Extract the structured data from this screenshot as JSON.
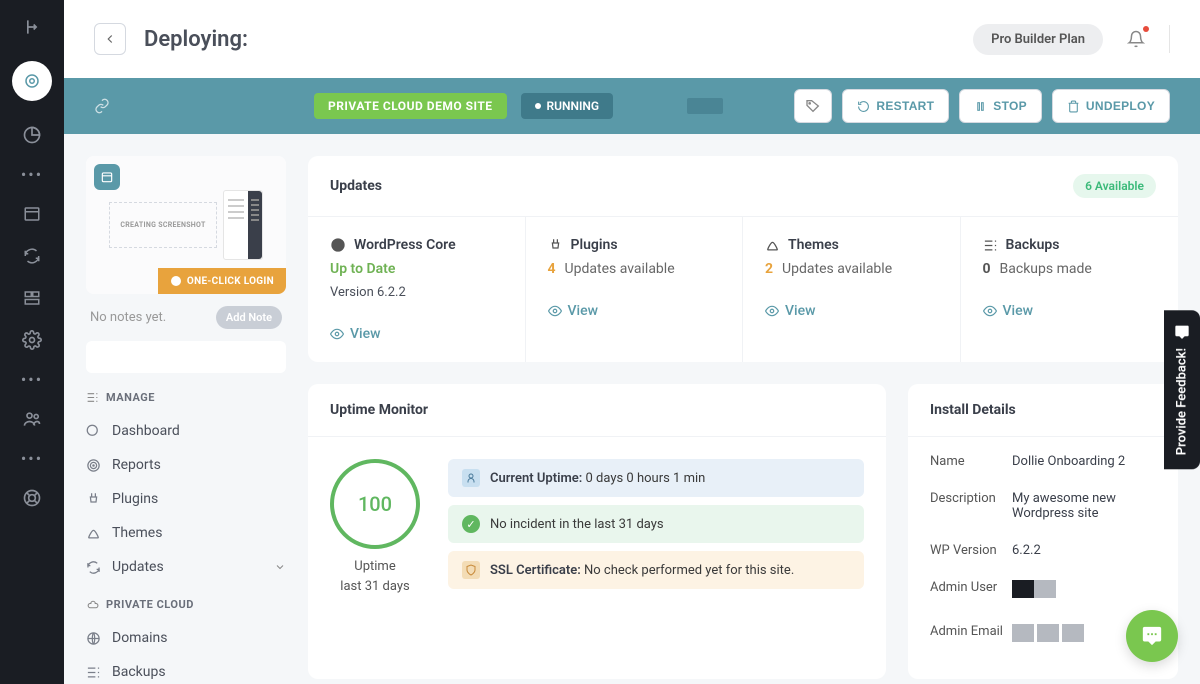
{
  "header": {
    "title": "Deploying:",
    "plan": "Pro Builder Plan"
  },
  "banner": {
    "site_badge": "PRIVATE CLOUD DEMO SITE",
    "status": "RUNNING",
    "restart": "RESTART",
    "stop": "STOP",
    "undeploy": "UNDEPLOY"
  },
  "preview": {
    "creating": "CREATING SCREENSHOT",
    "one_click": "ONE-CLICK LOGIN",
    "no_notes": "No notes yet.",
    "add_note": "Add Note"
  },
  "nav": {
    "manage_title": "MANAGE",
    "manage": [
      {
        "label": "Dashboard"
      },
      {
        "label": "Reports"
      },
      {
        "label": "Plugins"
      },
      {
        "label": "Themes"
      },
      {
        "label": "Updates"
      }
    ],
    "cloud_title": "PRIVATE CLOUD",
    "cloud": [
      {
        "label": "Domains"
      },
      {
        "label": "Backups"
      }
    ]
  },
  "updates": {
    "title": "Updates",
    "available_badge": "6 Available",
    "core": {
      "title": "WordPress Core",
      "status": "Up to Date",
      "version": "Version 6.2.2",
      "view": "View"
    },
    "plugins": {
      "title": "Plugins",
      "count": "4",
      "text": "Updates available",
      "view": "View"
    },
    "themes": {
      "title": "Themes",
      "count": "2",
      "text": "Updates available",
      "view": "View"
    },
    "backups": {
      "title": "Backups",
      "count": "0",
      "text": "Backups made",
      "view": "View"
    }
  },
  "uptime": {
    "title": "Uptime Monitor",
    "score": "100",
    "label1": "Uptime",
    "label2": "last 31 days",
    "row1_label": "Current Uptime:",
    "row1_val": " 0 days 0 hours 1 min",
    "row2": "No incident in the last 31 days",
    "row3_label": "SSL Certificate:",
    "row3_val": " No check performed yet for this site."
  },
  "details": {
    "title": "Install Details",
    "rows": {
      "name": {
        "label": "Name",
        "value": "Dollie Onboarding 2"
      },
      "desc": {
        "label": "Description",
        "value": "My awesome new Wordpress site"
      },
      "wp": {
        "label": "WP Version",
        "value": "6.2.2"
      },
      "admin_user": {
        "label": "Admin User"
      },
      "admin_email": {
        "label": "Admin Email"
      }
    }
  },
  "feedback": "Provide Feedback!"
}
